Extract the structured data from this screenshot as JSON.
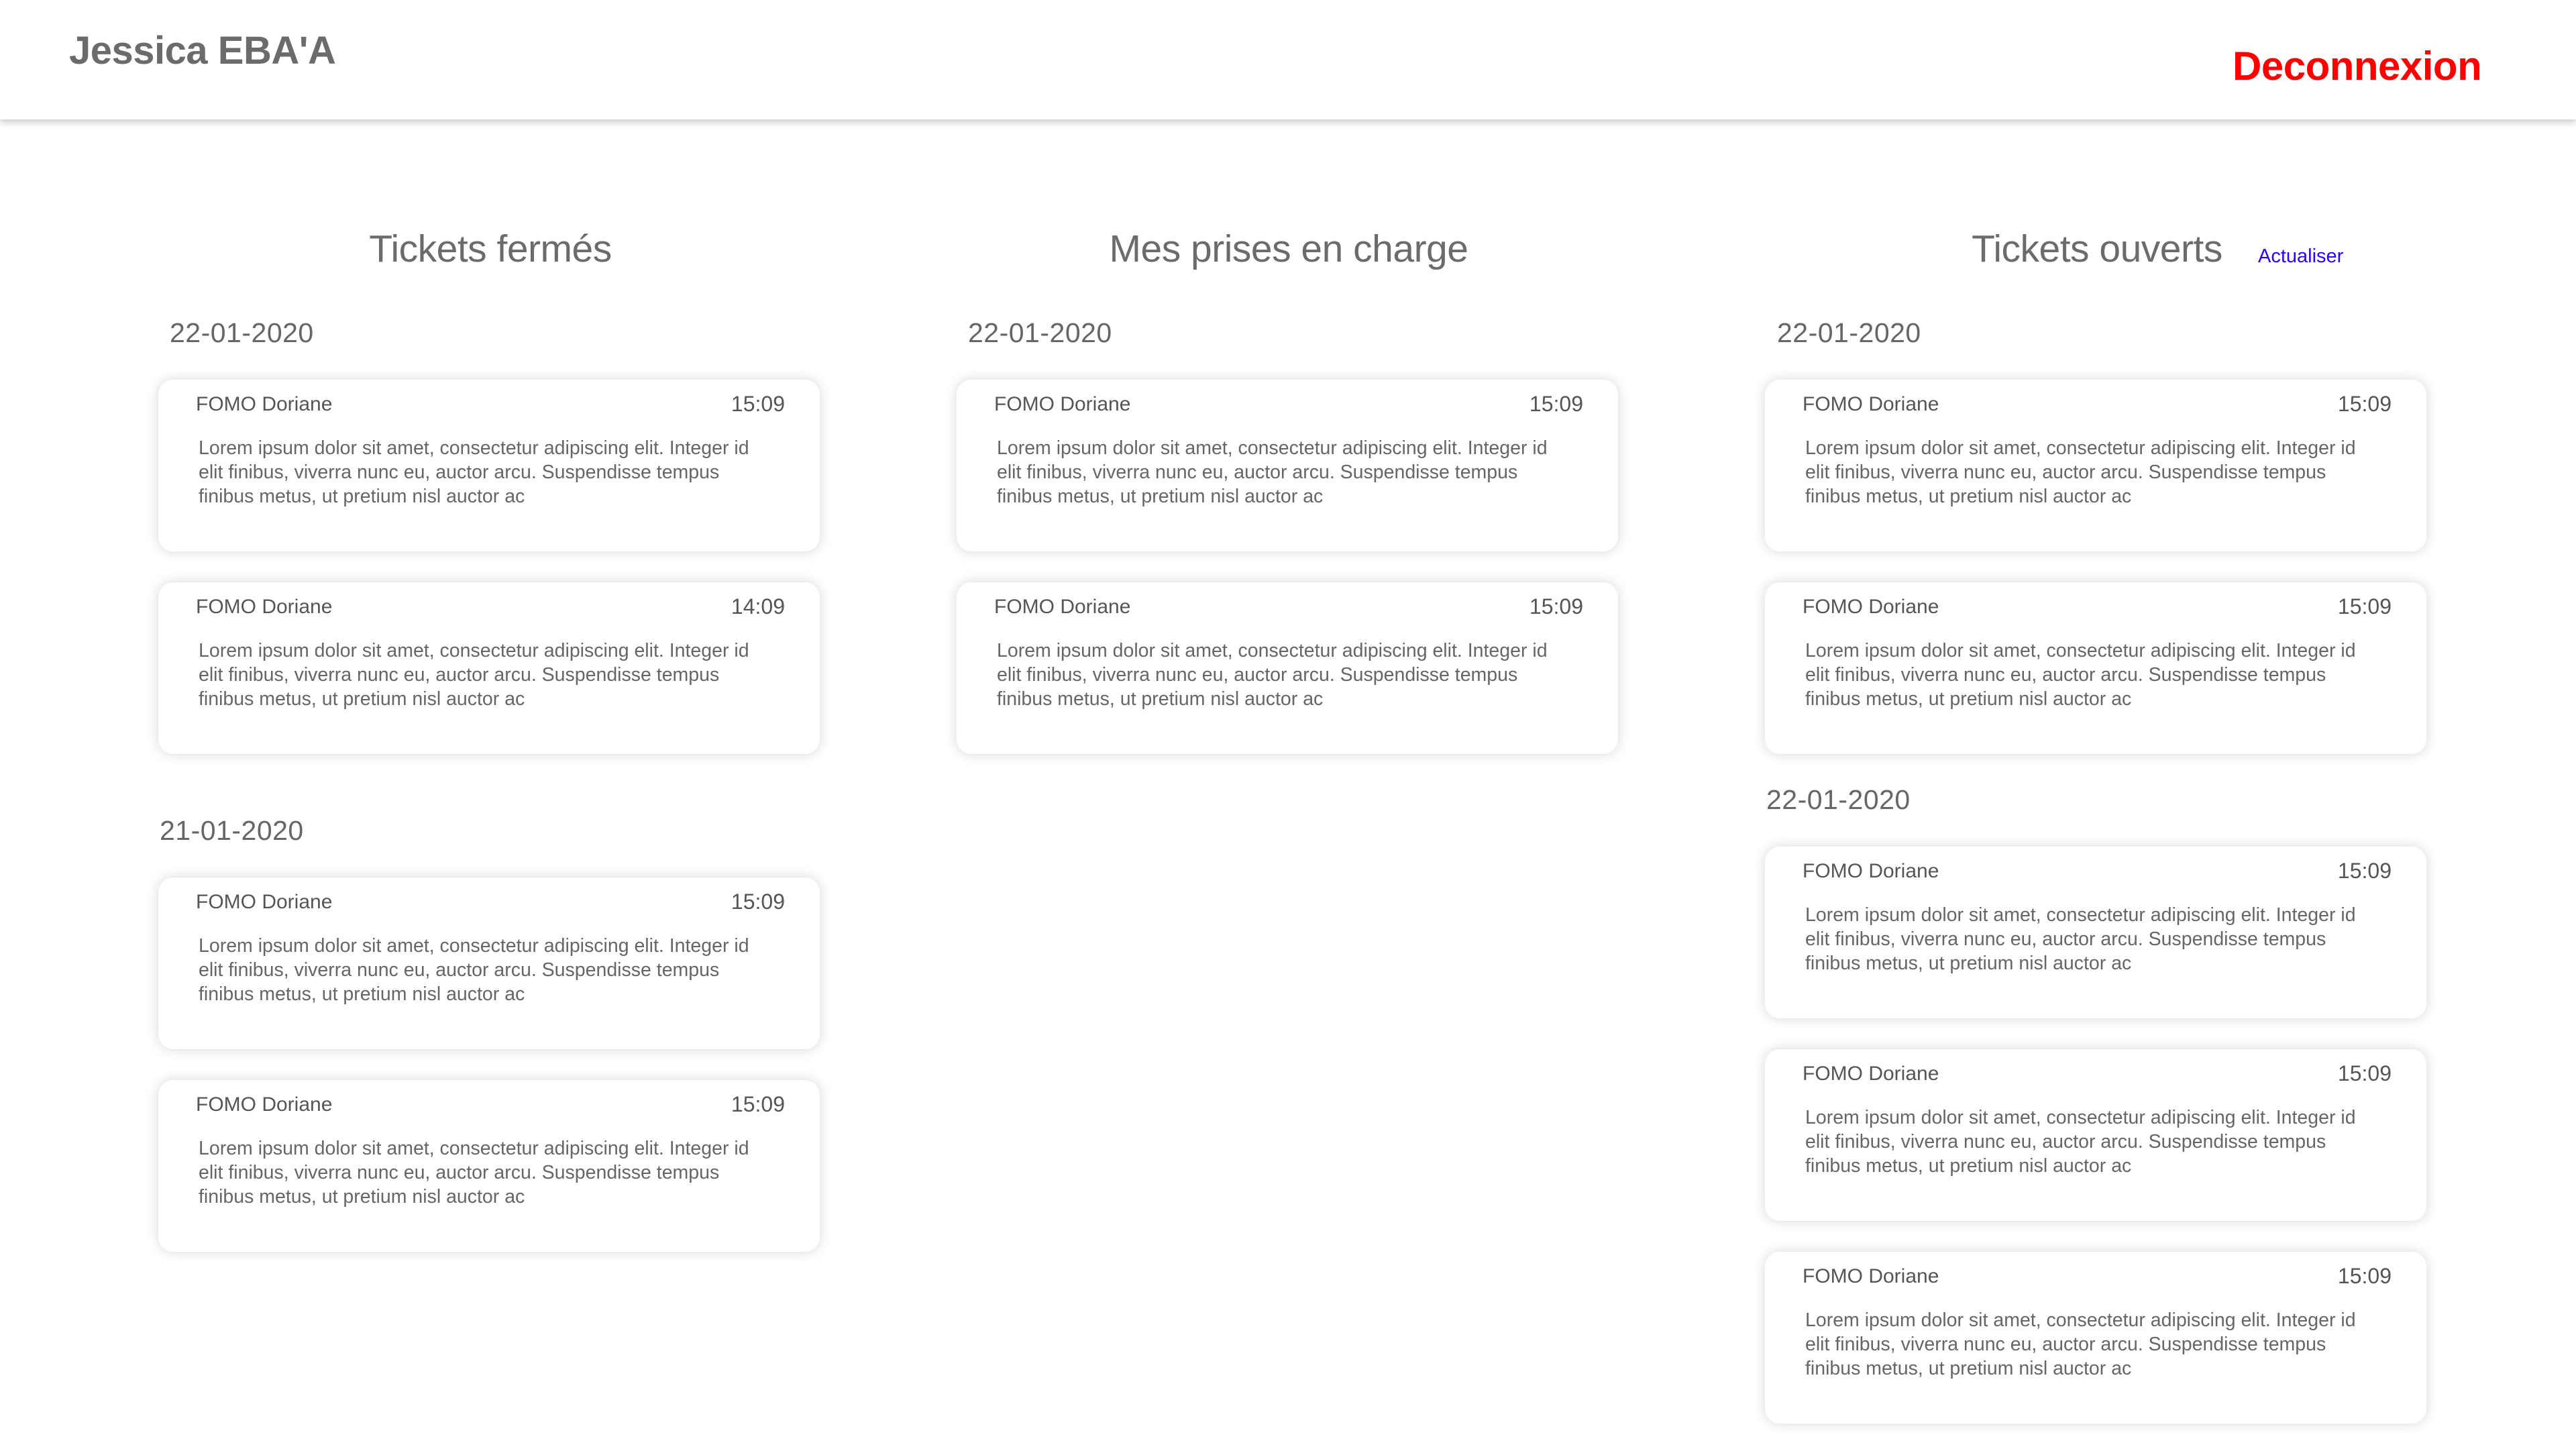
{
  "header": {
    "user_name": "Jessica EBA'A",
    "logout_label": "Deconnexion"
  },
  "colors": {
    "logout": "#ff0000",
    "refresh_link": "#2a00ff",
    "text": "#666666"
  },
  "columns": [
    {
      "title": "Tickets fermés",
      "groups": [
        {
          "date": "22-01-2020",
          "tickets": [
            {
              "author": "FOMO Doriane",
              "time": "15:09",
              "body": "Lorem ipsum dolor sit amet, consectetur adipiscing elit. Integer id elit finibus, viverra nunc eu, auctor arcu. Suspendisse tempus finibus metus, ut pretium nisl auctor ac"
            },
            {
              "author": "FOMO Doriane",
              "time": "14:09",
              "body": "Lorem ipsum dolor sit amet, consectetur adipiscing elit. Integer id elit finibus, viverra nunc eu, auctor arcu. Suspendisse tempus finibus metus, ut pretium nisl auctor ac"
            }
          ]
        },
        {
          "date": "21-01-2020",
          "tickets": [
            {
              "author": "FOMO Doriane",
              "time": "15:09",
              "body": "Lorem ipsum dolor sit amet, consectetur adipiscing elit. Integer id elit finibus, viverra nunc eu, auctor arcu. Suspendisse tempus finibus metus, ut pretium nisl auctor ac"
            },
            {
              "author": "FOMO Doriane",
              "time": "15:09",
              "body": "Lorem ipsum dolor sit amet, consectetur adipiscing elit. Integer id elit finibus, viverra nunc eu, auctor arcu. Suspendisse tempus finibus metus, ut pretium nisl auctor ac"
            }
          ]
        }
      ]
    },
    {
      "title": "Mes prises en charge",
      "groups": [
        {
          "date": "22-01-2020",
          "tickets": [
            {
              "author": "FOMO Doriane",
              "time": "15:09",
              "body": "Lorem ipsum dolor sit amet, consectetur adipiscing elit. Integer id elit finibus, viverra nunc eu, auctor arcu. Suspendisse tempus finibus metus, ut pretium nisl auctor ac"
            },
            {
              "author": "FOMO Doriane",
              "time": "15:09",
              "body": "Lorem ipsum dolor sit amet, consectetur adipiscing elit. Integer id elit finibus, viverra nunc eu, auctor arcu. Suspendisse tempus finibus metus, ut pretium nisl auctor ac"
            }
          ]
        }
      ]
    },
    {
      "title": "Tickets ouverts",
      "refresh_label": "Actualiser",
      "groups": [
        {
          "date": "22-01-2020",
          "tickets": [
            {
              "author": "FOMO Doriane",
              "time": "15:09",
              "body": "Lorem ipsum dolor sit amet, consectetur adipiscing elit. Integer id elit finibus, viverra nunc eu, auctor arcu. Suspendisse tempus finibus metus, ut pretium nisl auctor ac"
            },
            {
              "author": "FOMO Doriane",
              "time": "15:09",
              "body": "Lorem ipsum dolor sit amet, consectetur adipiscing elit. Integer id elit finibus, viverra nunc eu, auctor arcu. Suspendisse tempus finibus metus, ut pretium nisl auctor ac"
            }
          ]
        },
        {
          "date": "22-01-2020",
          "tickets": [
            {
              "author": "FOMO Doriane",
              "time": "15:09",
              "body": "Lorem ipsum dolor sit amet, consectetur adipiscing elit. Integer id elit finibus, viverra nunc eu, auctor arcu. Suspendisse tempus finibus metus, ut pretium nisl auctor ac"
            },
            {
              "author": "FOMO Doriane",
              "time": "15:09",
              "body": "Lorem ipsum dolor sit amet, consectetur adipiscing elit. Integer id elit finibus, viverra nunc eu, auctor arcu. Suspendisse tempus finibus metus, ut pretium nisl auctor ac"
            },
            {
              "author": "FOMO Doriane",
              "time": "15:09",
              "body": "Lorem ipsum dolor sit amet, consectetur adipiscing elit. Integer id elit finibus, viverra nunc eu, auctor arcu. Suspendisse tempus finibus metus, ut pretium nisl auctor ac"
            }
          ]
        }
      ]
    }
  ]
}
